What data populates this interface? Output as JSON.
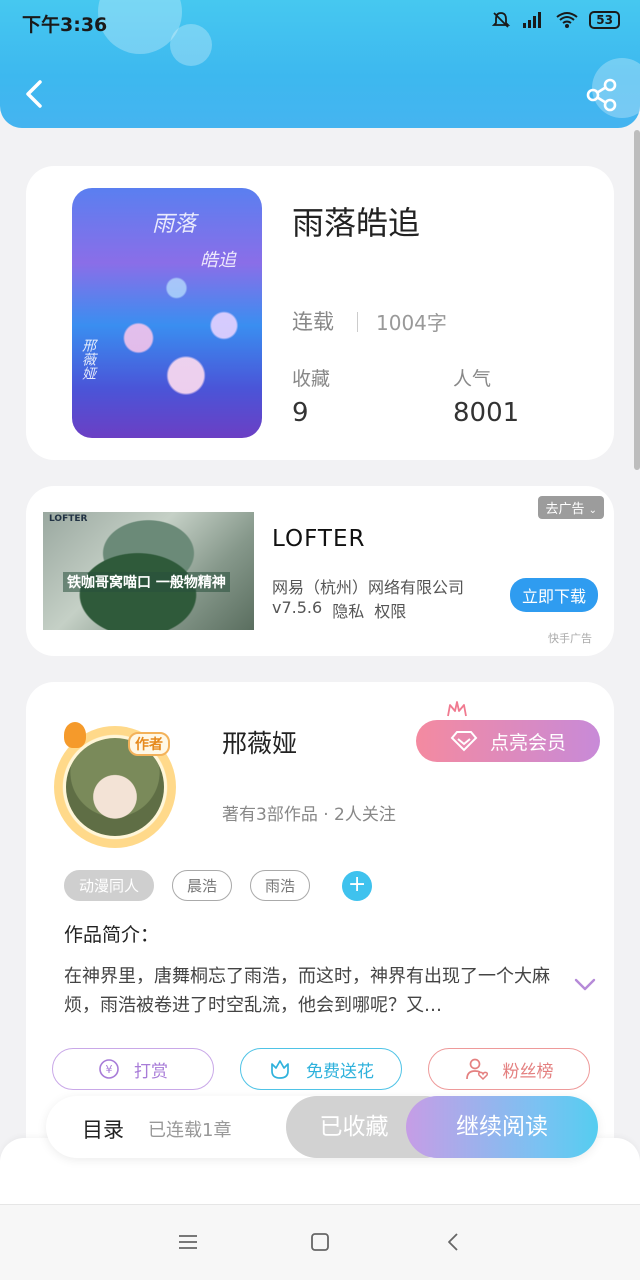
{
  "status_bar": {
    "time": "下午3:36",
    "battery": "53"
  },
  "header": {
    "back_icon": "back-arrow-icon",
    "share_icon": "share-icon"
  },
  "book": {
    "title": "雨落皓追",
    "cover_text_top": "雨落",
    "cover_text_right": "皓追",
    "cover_text_left": "邢薇娅",
    "status": "连载",
    "words": "1004字",
    "favorites_label": "收藏",
    "favorites_value": "9",
    "popularity_label": "人气",
    "popularity_value": "8001"
  },
  "ad": {
    "image_tag": "LOFTER",
    "image_text": "铁咖哥窝喵口 一般物精神",
    "app_name": "LOFTER",
    "company": "网易（杭州）网络有限公司",
    "version": "v7.5.6",
    "privacy": "隐私",
    "permissions": "权限",
    "remove_label": "去广告",
    "download_label": "立即下载",
    "source": "快手广告"
  },
  "author": {
    "name": "邢薇娅",
    "badge": "作者",
    "stats": "著有3部作品 · 2人关注",
    "vip_label": "点亮会员",
    "tags": [
      "动漫同人",
      "晨浩",
      "雨浩"
    ],
    "intro_title": "作品简介：",
    "intro_text": "在神界里，唐舞桐忘了雨浩，而这时，神界有出现了一个大麻烦，雨浩被卷进了时空乱流，他会到哪呢？又…"
  },
  "actions": {
    "tip": "打赏",
    "flower": "免费送花",
    "fans": "粉丝榜"
  },
  "bottom_bar": {
    "toc": "目录",
    "toc_sub": "已连载1章",
    "collected": "已收藏",
    "continue": "继续阅读"
  },
  "colors": {
    "accent": "#3fc2ee",
    "header": "#46c8f0",
    "vip": "#f48aa0"
  }
}
